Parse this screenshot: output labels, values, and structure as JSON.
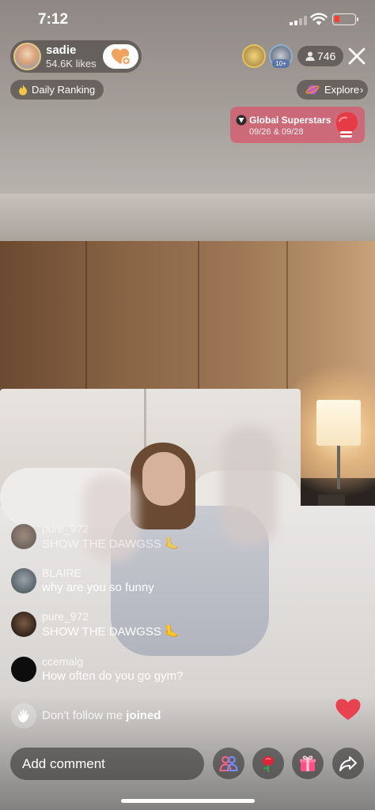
{
  "status_bar": {
    "time": "7:12",
    "battery_color": "#ff3b30"
  },
  "host": {
    "name": "sadie",
    "likes": "54.6K likes",
    "follow_icon": "heart-plus-icon"
  },
  "viewers": {
    "badge": "10+",
    "count": "746"
  },
  "daily_ranking": {
    "label": "Daily Ranking",
    "icon": "flame-icon"
  },
  "explore": {
    "label": "Explore",
    "chevron": "›",
    "icon": "planet-icon"
  },
  "superstars": {
    "title": "Global Superstars",
    "dates": "09/26 & 09/28",
    "icon": "boxing-glove-icon"
  },
  "comments": [
    {
      "username": "pure_972",
      "message": "SHOW THE DAWGSS 🦶"
    },
    {
      "username": "BLAIRE",
      "message": "why are you so funny"
    },
    {
      "username": "pure_972",
      "message": "SHOW THE DAWGSS 🦶"
    },
    {
      "username": "ccemalg",
      "message": "How often do you go gym?"
    }
  ],
  "join_notice": {
    "user": "Don't follow me",
    "action": "joined"
  },
  "bottom_bar": {
    "comment_placeholder": "Add comment",
    "buttons": [
      "multi-guest-icon",
      "rose-icon",
      "gift-icon",
      "share-icon"
    ]
  },
  "colors": {
    "accent_pink": "#d65a6e",
    "heart_red": "#e8414f",
    "follow_orange": "#f0a25e"
  }
}
